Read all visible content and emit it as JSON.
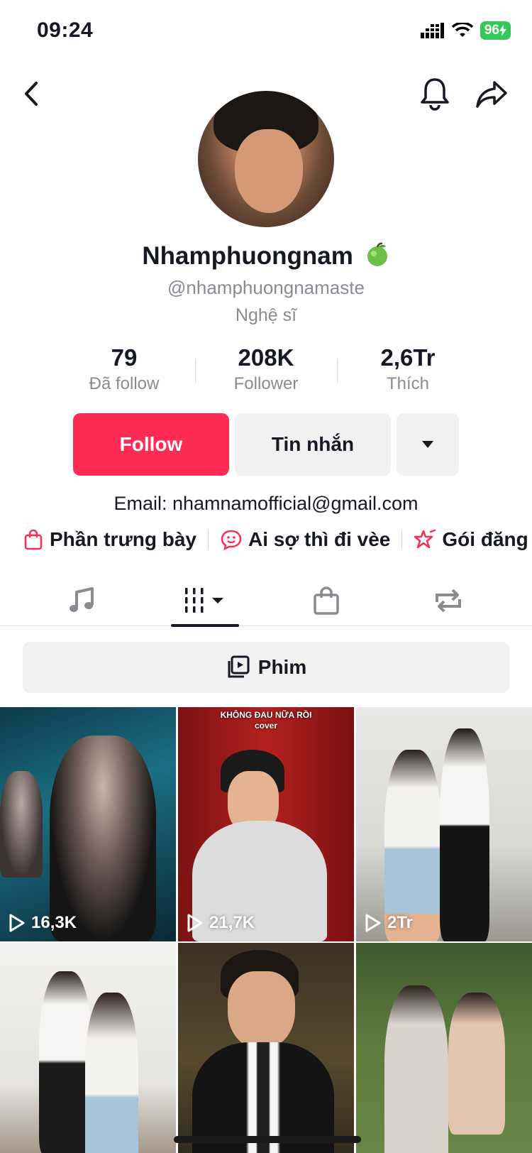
{
  "status_bar": {
    "time": "09:24",
    "battery": "96"
  },
  "profile": {
    "display_name": "Nhamphuongnam",
    "username": "@nhamphuongnamaste",
    "category": "Nghệ sĩ",
    "stats": [
      {
        "value": "79",
        "label": "Đã follow"
      },
      {
        "value": "208K",
        "label": "Follower"
      },
      {
        "value": "2,6Tr",
        "label": "Thích"
      }
    ],
    "actions": {
      "follow": "Follow",
      "message": "Tin nhắn"
    },
    "bio": "Email: nhamnamofficial@gmail.com",
    "links": [
      {
        "label": "Phần trưng bày",
        "icon": "shopping-bag-icon"
      },
      {
        "label": "Ai sợ thì đi vèe",
        "icon": "chat-emoji-icon"
      },
      {
        "label": "Gói đăng k",
        "icon": "subscription-star-icon"
      }
    ]
  },
  "tabs": [
    {
      "name": "music",
      "icon": "music-note-icon"
    },
    {
      "name": "videos",
      "icon": "video-grid-icon",
      "active": true
    },
    {
      "name": "shop",
      "icon": "shopping-bag-icon"
    },
    {
      "name": "reposts",
      "icon": "repost-icon"
    }
  ],
  "filter": {
    "label": "Phim"
  },
  "videos": [
    {
      "views": "16,3K"
    },
    {
      "views": "21,7K",
      "caption": "KHÔNG ĐAU NỮA RỒI\ncover"
    },
    {
      "views": "2Tr"
    },
    {
      "views": ""
    },
    {
      "views": ""
    },
    {
      "views": ""
    }
  ],
  "colors": {
    "accent": "#fe2c55",
    "text": "#161823",
    "muted": "#8a8b91",
    "battery": "#34c759"
  }
}
